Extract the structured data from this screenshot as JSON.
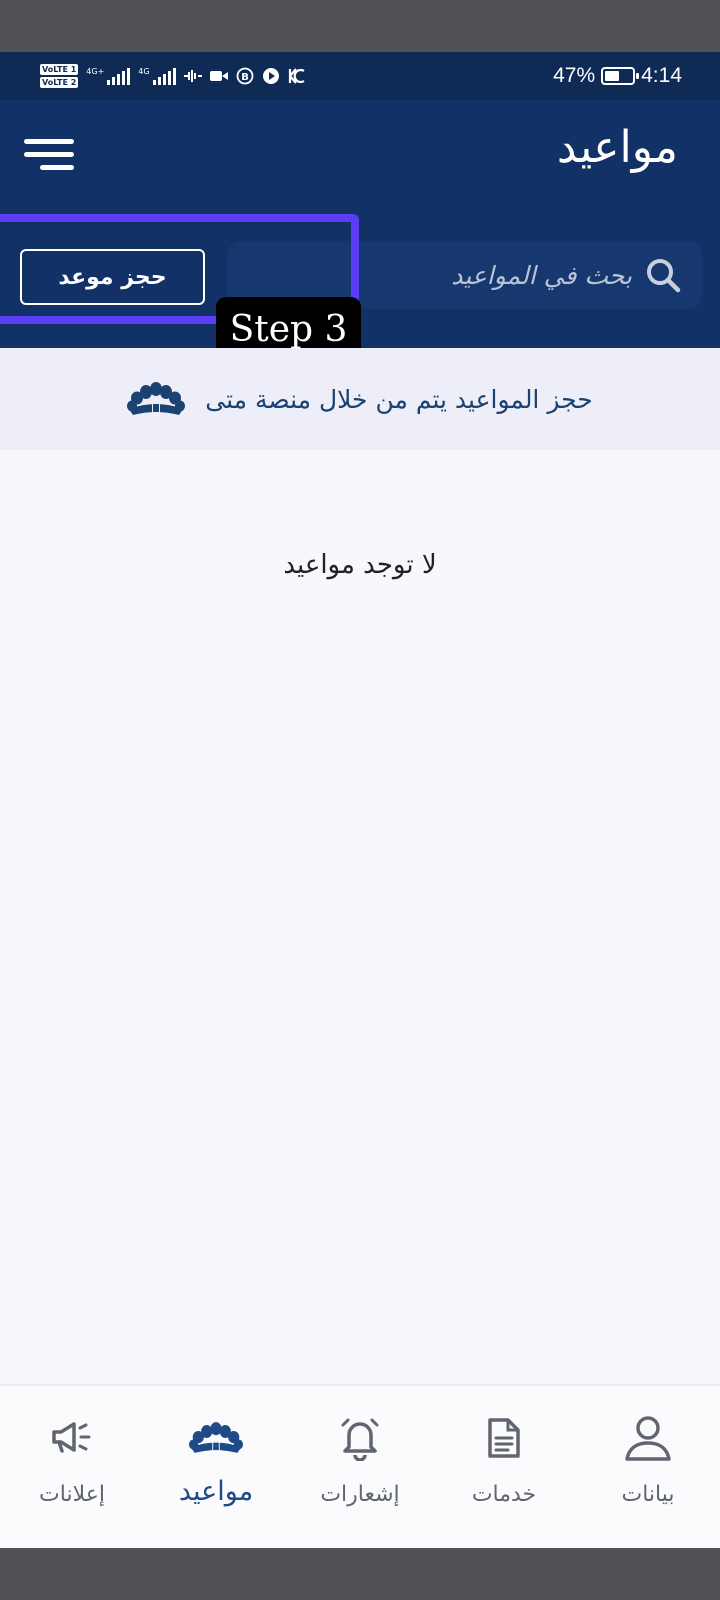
{
  "status_bar": {
    "volte1": "VoLTE 1",
    "volte2": "VoLTE 2",
    "net1": "4G+",
    "net2": "4G",
    "battery": "47%",
    "time": "4:14",
    "battery_level": 0.47
  },
  "header": {
    "title": "مواعيد",
    "search_placeholder": "بحث في المواعيد",
    "book_button": "حجز موعد"
  },
  "tutorial": {
    "step_label": "Step 3"
  },
  "banner": {
    "text": "حجز المواعيد يتم من خلال منصة متى"
  },
  "content": {
    "empty_message": "لا توجد مواعيد"
  },
  "bottom_nav": {
    "items": [
      {
        "label": "إعلانات",
        "icon": "megaphone-icon"
      },
      {
        "label": "مواعيد",
        "icon": "shell-logo-icon",
        "active": true
      },
      {
        "label": "إشعارات",
        "icon": "bell-icon"
      },
      {
        "label": "خدمات",
        "icon": "document-icon"
      },
      {
        "label": "بيانات",
        "icon": "person-icon"
      }
    ]
  },
  "colors": {
    "header": "#123166",
    "accent": "#1e4a87",
    "highlight": "#5a3df5",
    "banner_bg": "#edeef7"
  }
}
